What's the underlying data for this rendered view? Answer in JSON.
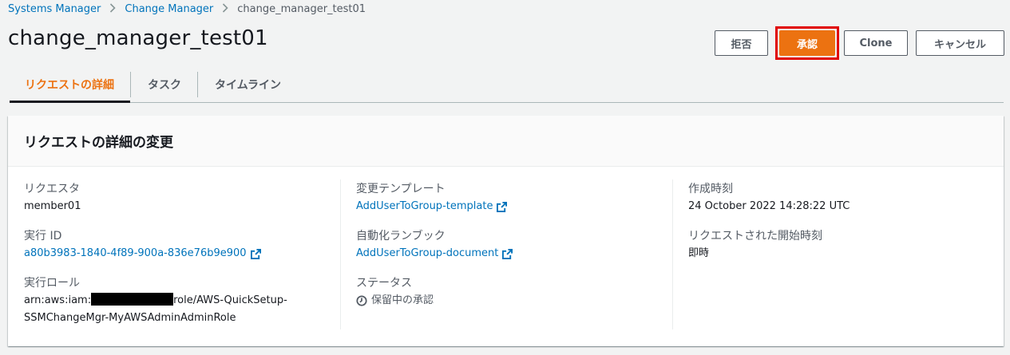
{
  "breadcrumb": {
    "items": [
      "Systems Manager",
      "Change Manager"
    ],
    "current": "change_manager_test01"
  },
  "title": "change_manager_test01",
  "actions": {
    "reject": "拒否",
    "approve": "承認",
    "clone": "Clone",
    "cancel": "キャンセル"
  },
  "tabs": [
    "リクエストの詳細",
    "タスク",
    "タイムライン"
  ],
  "panel": {
    "title": "リクエストの詳細の変更",
    "requester": {
      "label": "リクエスタ",
      "value": "member01"
    },
    "execution_id": {
      "label": "実行 ID",
      "value": "a80b3983-1840-4f89-900a-836e76b9e900"
    },
    "execution_role": {
      "label": "実行ロール",
      "value_prefix": "arn:aws:iam:",
      "value_suffix": "role/AWS-QuickSetup-",
      "value_line2": "SSMChangeMgr-MyAWSAdminAdminRole"
    },
    "change_template": {
      "label": "変更テンプレート",
      "value": "AddUserToGroup-template"
    },
    "runbook": {
      "label": "自動化ランブック",
      "value": "AddUserToGroup-document"
    },
    "status": {
      "label": "ステータス",
      "value": "保留中の承認",
      "icon": "clock-icon"
    },
    "created_time": {
      "label": "作成時刻",
      "value": "24 October 2022 14:28:22 UTC"
    },
    "requested_start": {
      "label": "リクエストされた開始時刻",
      "value": "即時"
    }
  },
  "colors": {
    "accent": "#ec7211",
    "link": "#0073bb",
    "highlight": "#e00000"
  }
}
